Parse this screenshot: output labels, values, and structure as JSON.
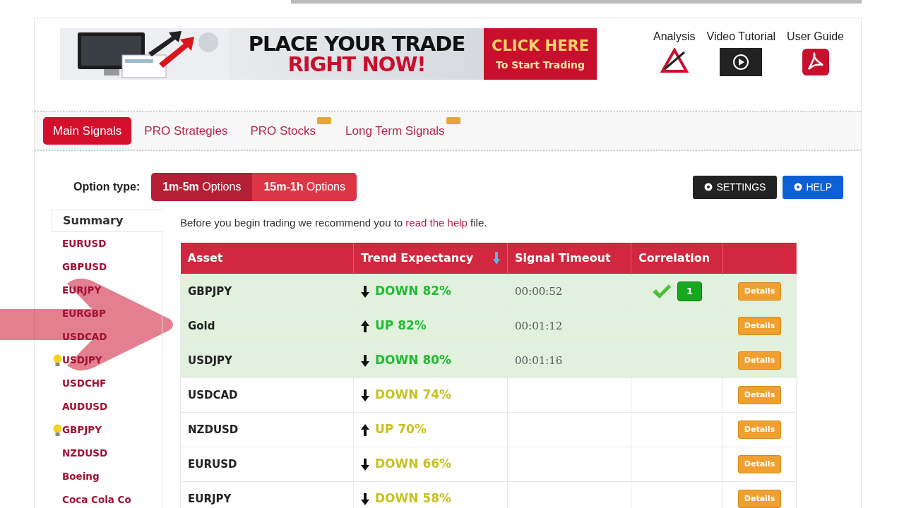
{
  "banner": {
    "headline_1": "PLACE YOUR TRADE",
    "headline_2": "RIGHT NOW!",
    "cta_1": "CLICK HERE",
    "cta_2": "To Start Trading"
  },
  "resources": [
    {
      "kind": "analysis",
      "label": "Analysis"
    },
    {
      "kind": "video",
      "label": "Video Tutorial"
    },
    {
      "kind": "pdf",
      "label": "User Guide"
    }
  ],
  "tabs": [
    {
      "label": "Main Signals",
      "selected": true,
      "is_new": false
    },
    {
      "label": "PRO Strategies",
      "selected": false,
      "is_new": false
    },
    {
      "label": "PRO Stocks",
      "selected": false,
      "is_new": true
    },
    {
      "label": "Long Term Signals",
      "selected": false,
      "is_new": true
    }
  ],
  "option_type": {
    "label": "Option type:",
    "options": [
      {
        "label_bold": "1m-5m",
        "label": "Options",
        "selected": true
      },
      {
        "label_bold": "15m-1h",
        "label": "Options",
        "selected": false
      }
    ]
  },
  "buttons": [
    {
      "kind": "settings",
      "label": "SETTINGS"
    },
    {
      "kind": "help",
      "label": "HELP"
    }
  ],
  "sidebar": {
    "title": "Summary",
    "items": [
      {
        "label": "EURUSD",
        "hint": false
      },
      {
        "label": "GBPUSD",
        "hint": false
      },
      {
        "label": "EURJPY",
        "hint": false
      },
      {
        "label": "EURGBP",
        "hint": false
      },
      {
        "label": "USDCAD",
        "hint": false
      },
      {
        "label": "USDJPY",
        "hint": true
      },
      {
        "label": "USDCHF",
        "hint": false
      },
      {
        "label": "AUDUSD",
        "hint": false
      },
      {
        "label": "GBPJPY",
        "hint": true
      },
      {
        "label": "NZDUSD",
        "hint": false
      },
      {
        "label": "Boeing",
        "hint": false
      },
      {
        "label": "Coca Cola Co",
        "hint": false
      }
    ]
  },
  "intro": {
    "before": "Before you begin trading we recommend you to",
    "link": "read the help",
    "after": "file."
  },
  "table": {
    "columns": [
      {
        "label": "Asset",
        "sorted": false
      },
      {
        "label": "Trend Expectancy",
        "sorted": true
      },
      {
        "label": "Signal Timeout",
        "sorted": false
      },
      {
        "label": "Correlation",
        "sorted": false
      }
    ],
    "rows": [
      {
        "asset": "GBPJPY",
        "kind": "down",
        "color": "#22bb33",
        "trend": "DOWN 82%",
        "timeout": "00:00:52",
        "correlation": "1",
        "highlighted": true,
        "action": "Details"
      },
      {
        "asset": "Gold",
        "kind": "up",
        "color": "#22bb33",
        "trend": "UP 82%",
        "timeout": "00:01:12",
        "highlighted": true,
        "action": "Details"
      },
      {
        "asset": "USDJPY",
        "kind": "down",
        "color": "#22bb33",
        "trend": "DOWN 80%",
        "timeout": "00:01:16",
        "highlighted": true,
        "action": "Details"
      },
      {
        "asset": "USDCAD",
        "kind": "down",
        "color": "#c8c222",
        "trend": "DOWN 74%",
        "highlighted": false,
        "action": "Details"
      },
      {
        "asset": "NZDUSD",
        "kind": "up",
        "color": "#c8c222",
        "trend": "UP 70%",
        "highlighted": false,
        "action": "Details"
      },
      {
        "asset": "EURUSD",
        "kind": "down",
        "color": "#c8c222",
        "trend": "DOWN 66%",
        "highlighted": false,
        "action": "Details"
      },
      {
        "asset": "EURJPY",
        "kind": "down",
        "color": "#c8c222",
        "trend": "DOWN 58%",
        "highlighted": false,
        "action": "Details"
      }
    ]
  }
}
